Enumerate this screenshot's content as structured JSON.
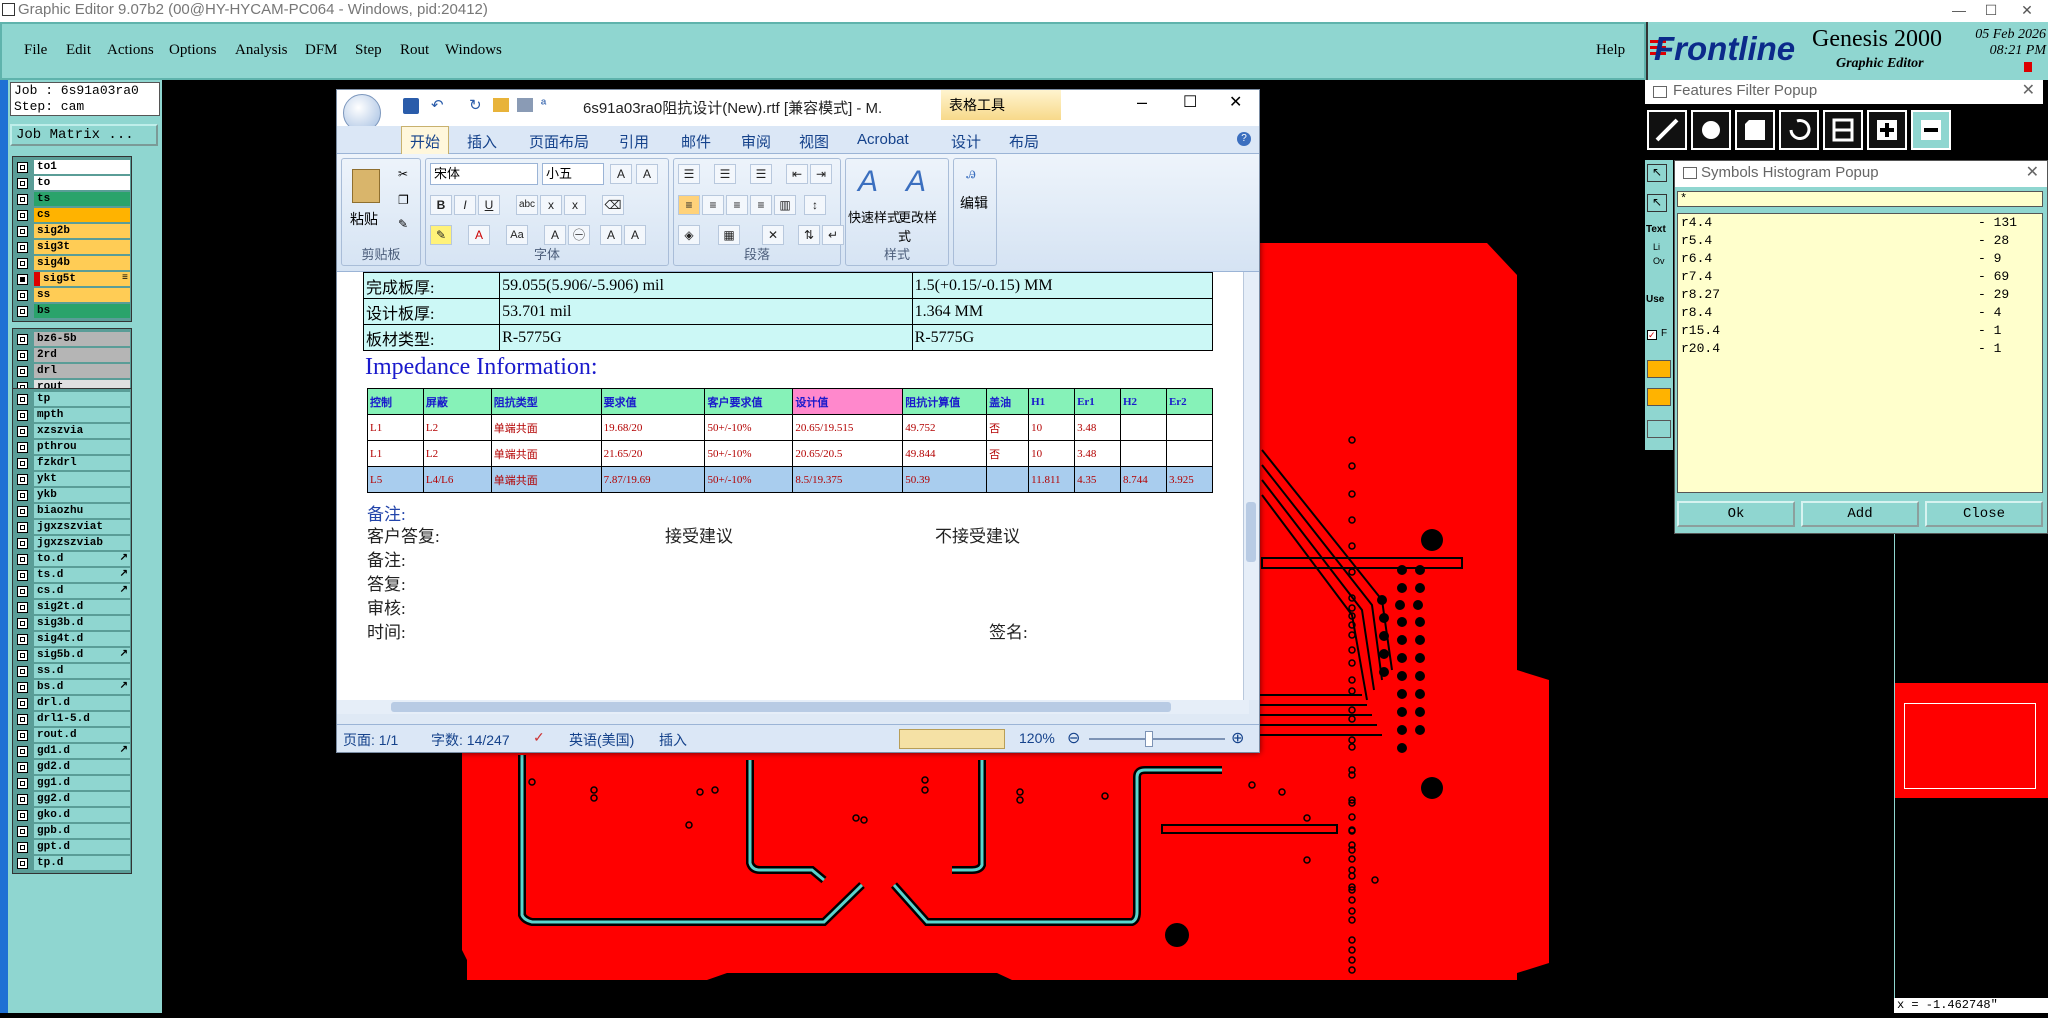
{
  "window": {
    "title": "Graphic Editor 9.07b2 (00@HY-HYCAM-PC064 - Windows, pid:20412)",
    "min": "—",
    "max": "☐",
    "close": "✕"
  },
  "menus": [
    "File",
    "Edit",
    "Actions",
    "Options",
    "Analysis",
    "DFM",
    "Step",
    "Rout",
    "Windows"
  ],
  "help": "Help",
  "logo": {
    "brand": "Frontline",
    "product": "Genesis 2000",
    "sub": "Graphic Editor",
    "date": "05 Feb 2026",
    "time": "08:21 PM"
  },
  "job": {
    "line1": "Job : 6s91a03ra0",
    "line2": "Step: cam",
    "matrix_btn": "Job Matrix ..."
  },
  "layer_groups": [
    [
      {
        "n": "to1",
        "c": "#ffffff"
      },
      {
        "n": "to",
        "c": "#ffffff"
      },
      {
        "n": "ts",
        "c": "#2aa36b"
      },
      {
        "n": "cs",
        "c": "#ffb300"
      },
      {
        "n": "sig2b",
        "c": "#ffcc55"
      },
      {
        "n": "sig3t",
        "c": "#ffcc55"
      },
      {
        "n": "sig4b",
        "c": "#ffcc55"
      },
      {
        "n": "sig5t",
        "c": "#ffcc55",
        "ic": "≡",
        "active": true
      },
      {
        "n": "ss",
        "c": "#ffcc55"
      },
      {
        "n": "bs",
        "c": "#2aa36b"
      }
    ],
    [
      {
        "n": "bz6-5b",
        "c": "#b5b5b5"
      },
      {
        "n": "2rd",
        "c": "#b5b5b5"
      },
      {
        "n": "drl",
        "c": "#b5b5b5"
      },
      {
        "n": "rout",
        "c": "#e0e0e0"
      }
    ],
    [
      {
        "n": "tp",
        "c": "#8fd6d0"
      },
      {
        "n": "mpth",
        "c": "#8fd6d0"
      },
      {
        "n": "xzszvia",
        "c": "#8fd6d0"
      },
      {
        "n": "pthrou",
        "c": "#8fd6d0"
      },
      {
        "n": "fzkdrl",
        "c": "#8fd6d0"
      },
      {
        "n": "ykt",
        "c": "#8fd6d0"
      },
      {
        "n": "ykb",
        "c": "#8fd6d0"
      },
      {
        "n": "biaozhu",
        "c": "#8fd6d0"
      },
      {
        "n": "jgxzszviat",
        "c": "#8fd6d0"
      },
      {
        "n": "jgxzszviab",
        "c": "#8fd6d0"
      },
      {
        "n": "to.d",
        "c": "#8fd6d0",
        "ic": "↗"
      },
      {
        "n": "ts.d",
        "c": "#8fd6d0",
        "ic": "↗"
      },
      {
        "n": "cs.d",
        "c": "#8fd6d0",
        "ic": "↗"
      },
      {
        "n": "sig2t.d",
        "c": "#8fd6d0"
      },
      {
        "n": "sig3b.d",
        "c": "#8fd6d0"
      },
      {
        "n": "sig4t.d",
        "c": "#8fd6d0"
      },
      {
        "n": "sig5b.d",
        "c": "#8fd6d0",
        "ic": "↗"
      },
      {
        "n": "ss.d",
        "c": "#8fd6d0"
      },
      {
        "n": "bs.d",
        "c": "#8fd6d0",
        "ic": "↗"
      },
      {
        "n": "drl.d",
        "c": "#8fd6d0"
      },
      {
        "n": "drl1-5.d",
        "c": "#8fd6d0"
      },
      {
        "n": "rout.d",
        "c": "#8fd6d0"
      },
      {
        "n": "gd1.d",
        "c": "#8fd6d0",
        "ic": "↗"
      },
      {
        "n": "gd2.d",
        "c": "#8fd6d0"
      },
      {
        "n": "gg1.d",
        "c": "#8fd6d0"
      },
      {
        "n": "gg2.d",
        "c": "#8fd6d0"
      },
      {
        "n": "gko.d",
        "c": "#8fd6d0"
      },
      {
        "n": "gpb.d",
        "c": "#8fd6d0"
      },
      {
        "n": "gpt.d",
        "c": "#8fd6d0"
      },
      {
        "n": "tp.d",
        "c": "#8fd6d0"
      }
    ]
  ],
  "word": {
    "title": "6s91a03ra0阻抗设计(New).rtf [兼容模式] - M.",
    "context_tab": "表格工具",
    "tabs": [
      "开始",
      "插入",
      "页面布局",
      "引用",
      "邮件",
      "审阅",
      "视图",
      "Acrobat",
      "设计",
      "布局"
    ],
    "font": "宋体",
    "size": "小五",
    "groups": [
      "剪贴板",
      "字体",
      "段落",
      "样式",
      "编辑"
    ],
    "paste": "粘贴",
    "quick_style": "快速样式",
    "change_style": "更改样式",
    "edit": "编辑",
    "top_rows": [
      [
        "完成板厚:",
        "59.055(5.906/-5.906) mil",
        "1.5(+0.15/-0.15) MM"
      ],
      [
        "设计板厚:",
        "53.701 mil",
        "1.364 MM"
      ],
      [
        "板材类型:",
        "R-5775G",
        "R-5775G"
      ]
    ],
    "impedance_title": "Impedance Information:",
    "imp_headers": [
      "控制",
      "屏蔽",
      "阻抗类型",
      "要求值",
      "客户要求值",
      "设计值",
      "阻抗计算值",
      "盖油",
      "H1",
      "Er1",
      "H2",
      "Er2"
    ],
    "imp_rows": [
      [
        "L1",
        "L2",
        "单端共面",
        "19.68/20",
        "50+/-10%",
        "20.65/19.515",
        "49.752",
        "否",
        "10",
        "3.48",
        "",
        ""
      ],
      [
        "L1",
        "L2",
        "单端共面",
        "21.65/20",
        "50+/-10%",
        "20.65/20.5",
        "49.844",
        "否",
        "10",
        "3.48",
        "",
        ""
      ],
      [
        "L5",
        "L4/L6",
        "单端共面",
        "7.87/19.69",
        "50+/-10%",
        "8.5/19.375",
        "50.39",
        "",
        "11.811",
        "4.35",
        "8.744",
        "3.925"
      ]
    ],
    "notes": {
      "remark1": "备注:",
      "reply": "客户答复:",
      "accept": "接受建议",
      "reject": "不接受建议",
      "remark2": "备注:",
      "answer": "答复:",
      "review": "审核:",
      "time": "时间:",
      "sign": "签名:"
    },
    "status": {
      "page": "页面: 1/1",
      "words": "字数: 14/247",
      "lang": "英语(美国)",
      "mode": "插入",
      "zoom": "120%"
    }
  },
  "features_filter": {
    "title": "Features Filter Popup"
  },
  "histogram": {
    "title": "Symbols Histogram Popup",
    "filter": "*",
    "rows": [
      [
        "r4.4",
        "- 131"
      ],
      [
        "r5.4",
        "- 28"
      ],
      [
        "r6.4",
        "- 9"
      ],
      [
        "r7.4",
        "- 69"
      ],
      [
        "r8.27",
        "- 29"
      ],
      [
        "r8.4",
        "- 4"
      ],
      [
        "r15.4",
        "- 1"
      ],
      [
        "r20.4",
        "- 1"
      ]
    ],
    "buttons": [
      "Ok",
      "Add",
      "Close"
    ]
  },
  "side_labels": [
    "Text",
    "Li",
    "Ov",
    "Use",
    "F"
  ],
  "coord": "x = -1.462748\""
}
